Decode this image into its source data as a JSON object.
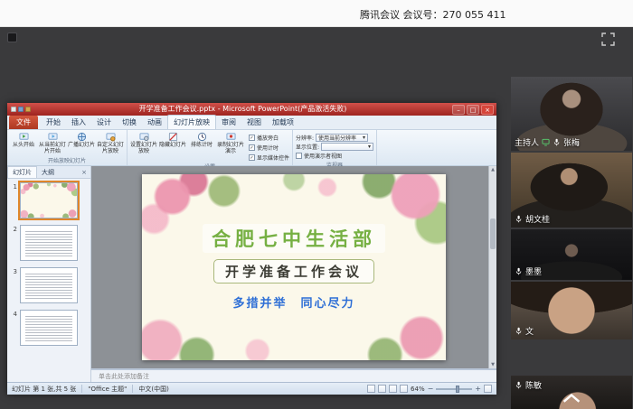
{
  "meeting": {
    "topbar_title": "腾讯会议 会议号：270 055 411"
  },
  "ppt": {
    "title": "开学准备工作会议.pptx - Microsoft PowerPoint(产品激活失败)",
    "tabs": [
      "文件",
      "开始",
      "插入",
      "设计",
      "切换",
      "动画",
      "幻灯片放映",
      "审阅",
      "视图",
      "加载项"
    ],
    "active_tab": "幻灯片放映",
    "ribbon": {
      "groups": [
        {
          "label": "开始放映幻灯片",
          "buttons": [
            "从头开始",
            "从当前幻灯片开始",
            "广播幻灯片",
            "自定义幻灯片放映"
          ]
        },
        {
          "label": "设置",
          "buttons": [
            "设置幻灯片放映",
            "隐藏幻灯片",
            "排练计时",
            "录制幻灯片演示"
          ],
          "checkboxes": [
            "播放旁白",
            "使用计时",
            "显示媒体控件"
          ]
        },
        {
          "label": "监视器",
          "fields": [
            {
              "label": "分辨率:",
              "value": "使用当前分辨率"
            },
            {
              "label": "显示位置:",
              "value": ""
            }
          ],
          "checkbox": "使用演示者视图"
        }
      ]
    },
    "panel": {
      "tabs": [
        "幻灯片",
        "大纲"
      ],
      "close": "×",
      "thumb_numbers": [
        "1",
        "2",
        "3",
        "4"
      ]
    },
    "slide": {
      "line1": "合肥七中生活部",
      "line2": "开学准备工作会议",
      "line3": "多措并举　同心尽力"
    },
    "notes_placeholder": "单击此处添加备注",
    "status": {
      "slide_info": "幻灯片 第 1 张,共 5 张",
      "theme": "\"Office 主题\"",
      "language": "中文(中国)",
      "zoom": "64%"
    }
  },
  "participants": [
    {
      "name": "张梅",
      "role": "主持人"
    },
    {
      "name": "胡文桂",
      "role": ""
    },
    {
      "name": "墨墨",
      "role": ""
    },
    {
      "name": "文",
      "role": ""
    },
    {
      "name": "陈敏",
      "role": ""
    }
  ],
  "glyphs": {
    "minimize": "–",
    "maximize": "□",
    "close": "×",
    "caret": "▾",
    "check": "✓",
    "arrow_up": "▲",
    "arrow_down": "▼",
    "zoom_out": "−",
    "zoom_in": "+"
  },
  "colors": {
    "ppt_titlebar": "#b3322b",
    "file_tab": "#c5462f",
    "slide_title_green": "#76b043",
    "slide_slogan_blue": "#2e6fd6",
    "selected_thumb": "#e0862a"
  }
}
